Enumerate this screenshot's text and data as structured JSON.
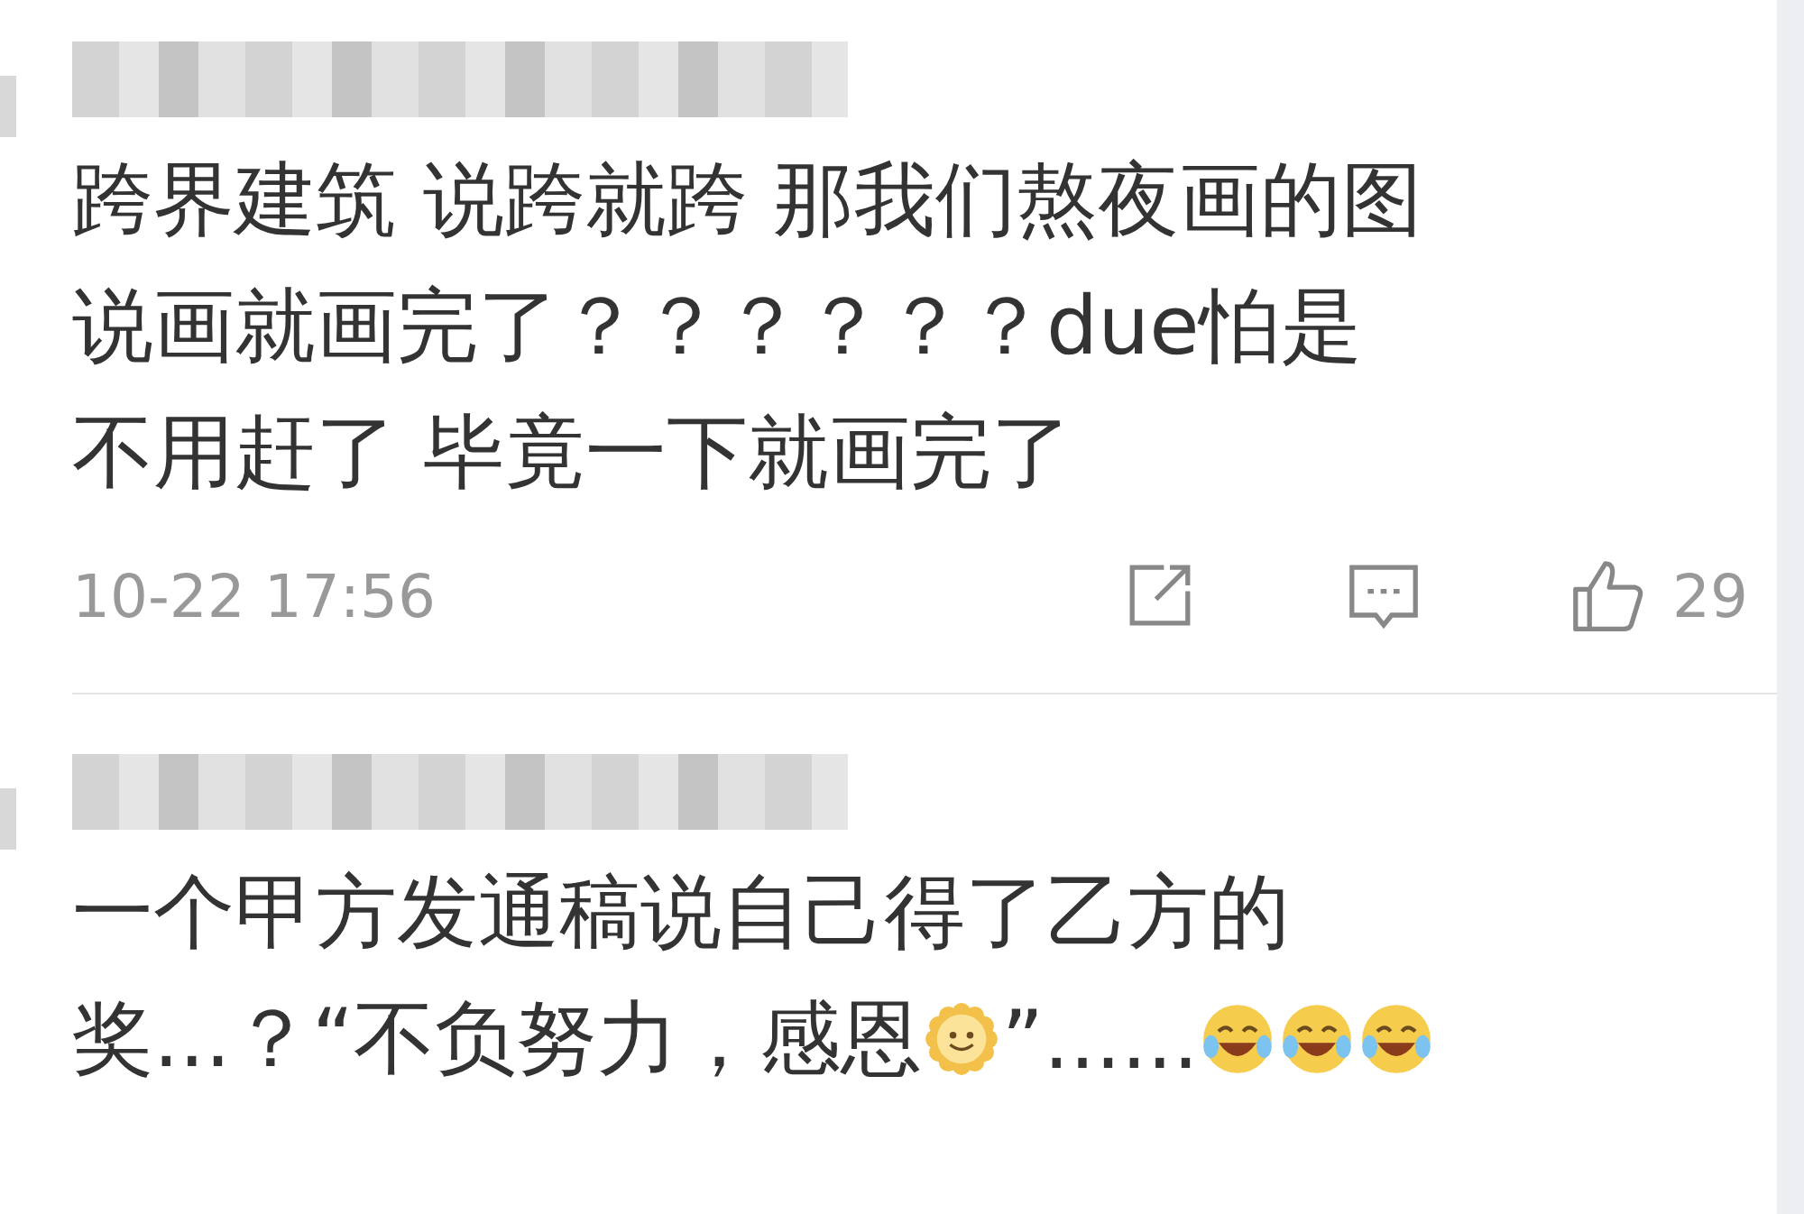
{
  "comments": [
    {
      "lines": [
        [
          {
            "kind": "text",
            "text": "跨界建筑 说跨就跨 那我们熬夜画的图"
          }
        ],
        [
          {
            "kind": "text",
            "text": "说画就画完了？？？？？？due怕是"
          }
        ],
        [
          {
            "kind": "text",
            "text": "不用赶了 毕竟一下就画完了"
          }
        ]
      ],
      "time": "10-22 17:56",
      "likes": "29"
    },
    {
      "lines": [
        [
          {
            "kind": "text",
            "text": "一个甲方发通稿说自己得了乙方的"
          }
        ],
        [
          {
            "kind": "text",
            "text": "奖...？“不负努力，感恩"
          },
          {
            "kind": "sun"
          },
          {
            "kind": "text",
            "text": "”......"
          },
          {
            "kind": "laugh"
          },
          {
            "kind": "laugh"
          },
          {
            "kind": "laugh"
          }
        ]
      ]
    }
  ]
}
